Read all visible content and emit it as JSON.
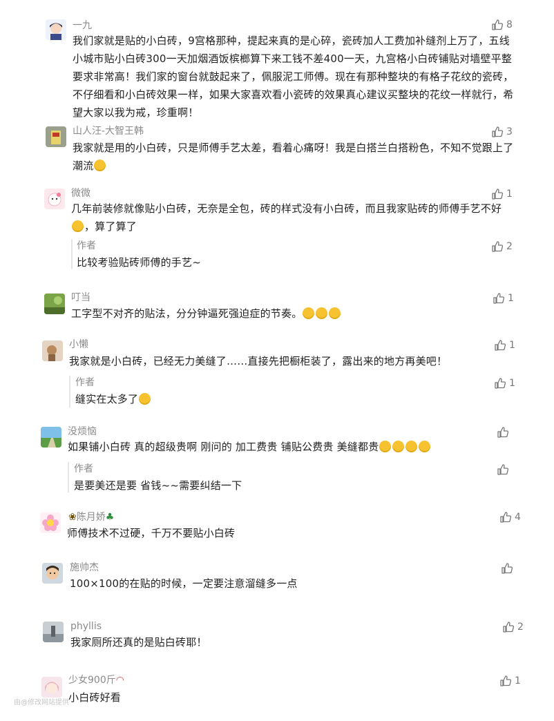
{
  "comments": [
    {
      "user": "一九",
      "likes": "8",
      "text": "我们家就是贴的小白砖，9宫格那种，提起来真的是心碎，瓷砖加人工费加补缝剂上万了，五线小城市贴小白砖300一天加烟酒饭槟榔算下来工钱不差400一天，九宫格小白砖铺贴对墙壁平整要求非常高！我们家的窗台就鼓起来了，佩服泥工师傅。现在有那种整块的有格子花纹的瓷砖，不仔细看和小白砖效果一样，如果大家喜欢看小瓷砖的效果真心建议买整块的花纹一样就行，希望大家以我为戒，珍重啊！"
    },
    {
      "user": "山人汪-大智王韩",
      "likes": "3",
      "text": "我家就是用的小白砖，只是师傅手艺太差，看着心痛呀！我是白搭兰白搭粉色，不知不觉跟上了潮流"
    },
    {
      "user": "微微",
      "likes": "1",
      "text_a": "几年前装修就像贴小白砖，无奈是全包，砖的样式没有小白砖，而且我家贴砖的师傅手艺不好",
      "text_b": "，算了算了",
      "reply": {
        "user": "作者",
        "likes": "2",
        "text": "比较考验贴砖师傅的手艺~"
      }
    },
    {
      "user": "叮当",
      "likes": "1",
      "text": "工字型不对齐的贴法，分分钟逼死强迫症的节奏。"
    },
    {
      "user": "小懒",
      "likes": "1",
      "text": "我家就是小白砖，已经无力美缝了……直接先把橱柜装了，露出来的地方再美吧！",
      "reply": {
        "user": "作者",
        "likes": "1",
        "text": "缝实在太多了"
      }
    },
    {
      "user": "没烦恼",
      "likes": "",
      "text": "如果铺小白砖 真的超级贵啊 刚问的 加工费贵 铺贴公费贵 美缝都贵",
      "reply": {
        "user": "作者",
        "likes": "",
        "text": "是要美还是要 省钱~~需要纠结一下"
      }
    },
    {
      "user": "陈月娇",
      "likes": "4",
      "text": "师傅技术不过硬，千万不要贴小白砖"
    },
    {
      "user": "施帅杰",
      "likes": "",
      "text": "100×100的在贴的时候，一定要注意溜缝多一点"
    },
    {
      "user": "phyllis",
      "likes": "2",
      "text": "我家厕所还真的是贴白砖耶！"
    },
    {
      "user": "少女900斤",
      "likes": "1",
      "text": "小白砖好看"
    }
  ],
  "watermark": "由@修改网站提供",
  "icons": {
    "like": "thumbs-up-icon"
  }
}
